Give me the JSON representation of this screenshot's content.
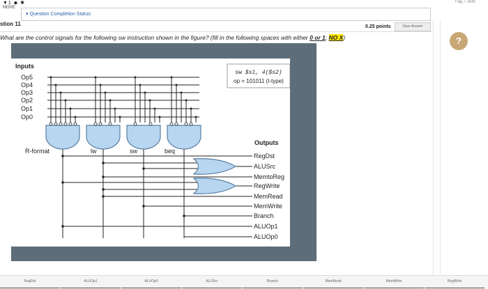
{
  "topbar": {
    "icons": "▼1 ◆ ✱",
    "right": "•  ɑɥ  ♂  A/IV",
    "move_label": "MOVE"
  },
  "status": {
    "label": "Question Completion Status:",
    "chevron": "chevron-down-icon"
  },
  "question": {
    "number_label": "stion 11",
    "points": "0.25 points",
    "save_label": "Save Answer",
    "text_pre": "What are the control signals for the following sw instruction shown in the figure? (fill in the following spaces with either ",
    "text_u": "0 or 1",
    "text_sep": "; ",
    "text_hl": "NO X",
    "text_post": ")"
  },
  "help": {
    "icon": "question-icon",
    "glyph": "?"
  },
  "figure": {
    "inputs_title": "Inputs",
    "inputs": [
      "Op5",
      "Op4",
      "Op3",
      "Op2",
      "Op1",
      "Op0"
    ],
    "instr_line1": "sw $s1, 4($s2)",
    "instr_line2": "op = 101011 (I-type)",
    "gate_labels": [
      "R-format",
      "lw",
      "sw",
      "beq"
    ],
    "outputs_title": "Outputs",
    "outputs": [
      "RegDst",
      "ALUSrc",
      "MemtoReg",
      "RegWrite",
      "MemRead",
      "MemWrite",
      "Branch",
      "ALUOp1",
      "ALUOp0"
    ]
  },
  "answer_fields": [
    "RegDst",
    "ALUOp1",
    "ALUOp0",
    "ALUSrc",
    "Branch",
    "MemRead",
    "MemWrite",
    "RegWrite"
  ],
  "colors": {
    "frame": "#5d6d79",
    "gate_fill": "#b8d6f0",
    "gate_stroke": "#5a7fa3",
    "highlight": "#ffe600",
    "link": "#2a5ea8",
    "help": "#c7a775"
  }
}
